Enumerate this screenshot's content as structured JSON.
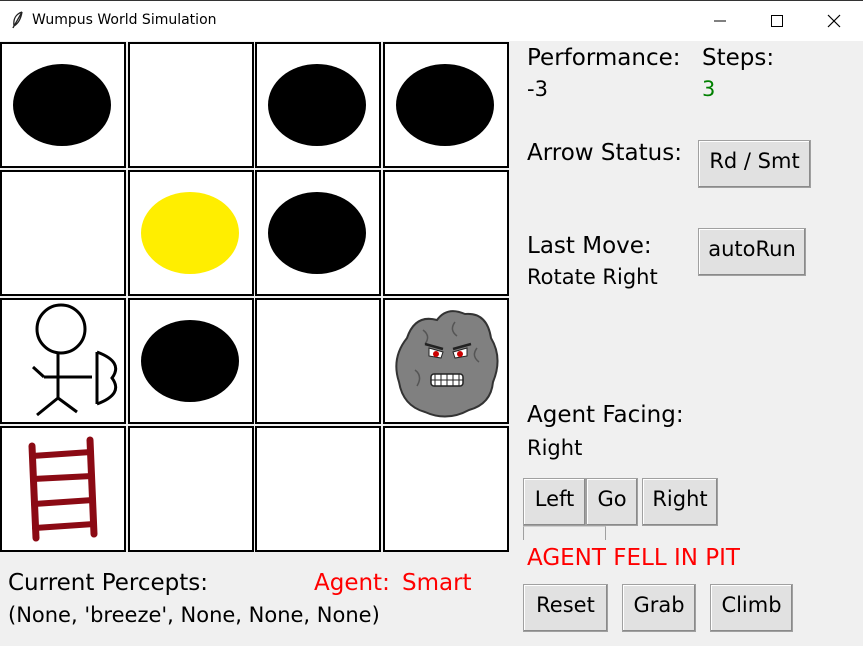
{
  "window": {
    "title": "Wumpus World Simulation",
    "app_icon": "feather-icon",
    "controls": [
      "minimize-icon",
      "maximize-icon",
      "close-icon"
    ]
  },
  "grid": {
    "rows": 4,
    "cols": 4,
    "cells": [
      [
        "pit",
        "empty",
        "pit",
        "pit"
      ],
      [
        "empty",
        "gold",
        "pit",
        "empty"
      ],
      [
        "agent",
        "pit",
        "empty",
        "wumpus"
      ],
      [
        "ladder",
        "empty",
        "empty",
        "empty"
      ]
    ]
  },
  "performance": {
    "label": "Performance:",
    "value": "-3"
  },
  "steps": {
    "label": "Steps:",
    "value": "3"
  },
  "arrow": {
    "label": "Arrow Status:",
    "button_label": "Rd / Smt"
  },
  "last_move": {
    "label": "Last Move:",
    "value": "Rotate Right"
  },
  "autorun": {
    "label": "autoRun"
  },
  "facing": {
    "label": "Agent Facing:",
    "value": "Right"
  },
  "move_buttons": {
    "left": "Left",
    "go": "Go",
    "right": "Right"
  },
  "status_message": "AGENT FELL IN PIT",
  "action_buttons": {
    "reset": "Reset",
    "grab": "Grab",
    "climb": "Climb"
  },
  "percepts": {
    "label": "Current Percepts:",
    "value": "(None, 'breeze', None, None, None)"
  },
  "agent_type": {
    "label": "Agent:",
    "value": "Smart"
  },
  "colors": {
    "pit": "#000000",
    "gold": "#ffee00",
    "ladder": "#8b0a14",
    "wumpus": "#808080",
    "steps_value": "#008000",
    "alert": "#ff0000",
    "background": "#f0f0f0"
  }
}
